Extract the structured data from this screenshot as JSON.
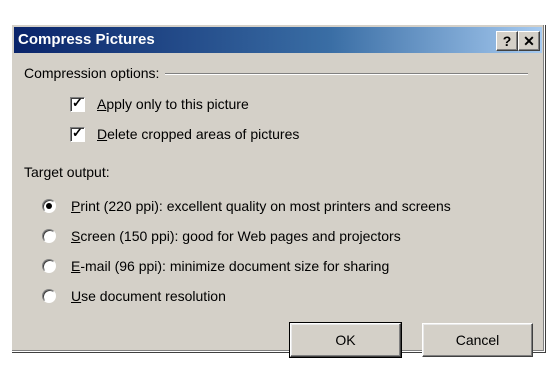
{
  "dialog": {
    "title": "Compress Pictures",
    "help_label": "?",
    "close_label": "✕"
  },
  "compression": {
    "label": "Compression options:",
    "options": [
      {
        "prefix": "",
        "hotkey": "A",
        "rest": "pply only to this picture",
        "checked": true
      },
      {
        "prefix": "",
        "hotkey": "D",
        "rest": "elete cropped areas of pictures",
        "checked": true
      }
    ],
    "check_mark": "✓"
  },
  "target": {
    "label": "Target output:",
    "options": [
      {
        "hotkey": "P",
        "rest": "rint (220 ppi): excellent quality on most printers and screens",
        "selected": true
      },
      {
        "hotkey": "S",
        "rest": "creen (150 ppi): good for Web pages and projectors",
        "selected": false
      },
      {
        "hotkey": "E",
        "rest": "-mail (96 ppi): minimize document size for sharing",
        "selected": false
      },
      {
        "hotkey": "U",
        "rest": "se document resolution",
        "selected": false
      }
    ]
  },
  "buttons": {
    "ok": "OK",
    "cancel": "Cancel"
  }
}
